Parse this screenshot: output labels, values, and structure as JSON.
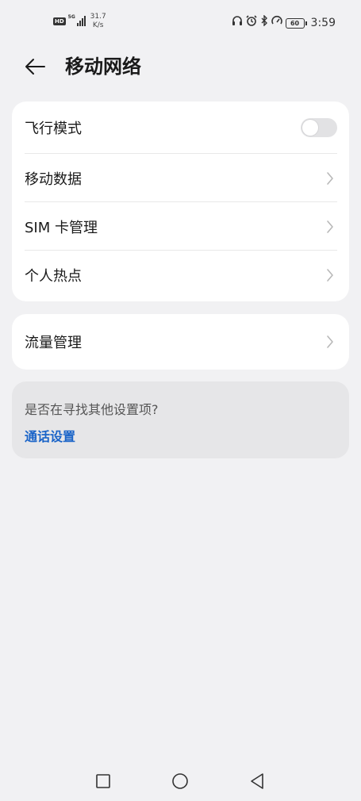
{
  "status_bar": {
    "hd": "HD",
    "network": "5G",
    "speed_value": "31.7",
    "speed_unit": "K/s",
    "battery": "60",
    "time": "3:59"
  },
  "header": {
    "title": "移动网络"
  },
  "card1": {
    "items": [
      {
        "label": "飞行模式",
        "type": "toggle",
        "on": false
      },
      {
        "label": "移动数据",
        "type": "link"
      },
      {
        "label": "SIM 卡管理",
        "type": "link"
      },
      {
        "label": "个人热点",
        "type": "link"
      }
    ]
  },
  "card2": {
    "items": [
      {
        "label": "流量管理",
        "type": "link"
      }
    ]
  },
  "suggestion": {
    "question": "是否在寻找其他设置项?",
    "link": "通话设置"
  },
  "colors": {
    "background": "#f1f1f3",
    "card": "#ffffff",
    "link": "#1a64c8",
    "toggle_off": "#e2e2e4"
  }
}
